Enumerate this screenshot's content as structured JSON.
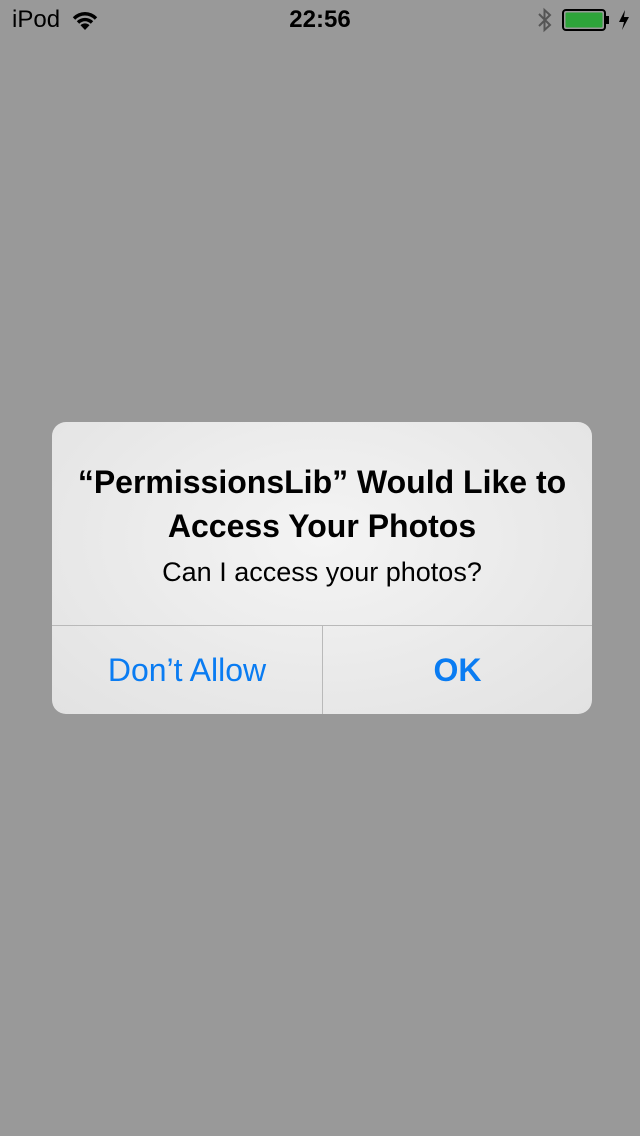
{
  "status_bar": {
    "carrier": "iPod",
    "time": "22:56",
    "icons": [
      "wifi-icon",
      "bluetooth-icon",
      "battery-icon",
      "charging-bolt-icon"
    ],
    "battery_color": "#2ea43a"
  },
  "alert": {
    "title": "“PermissionsLib” Would Like to Access Your Photos",
    "message": "Can I access your photos?",
    "buttons": {
      "dont_allow": "Don’t Allow",
      "ok": "OK"
    },
    "button_color": "#0a7cf2"
  },
  "background_color": "#999999"
}
